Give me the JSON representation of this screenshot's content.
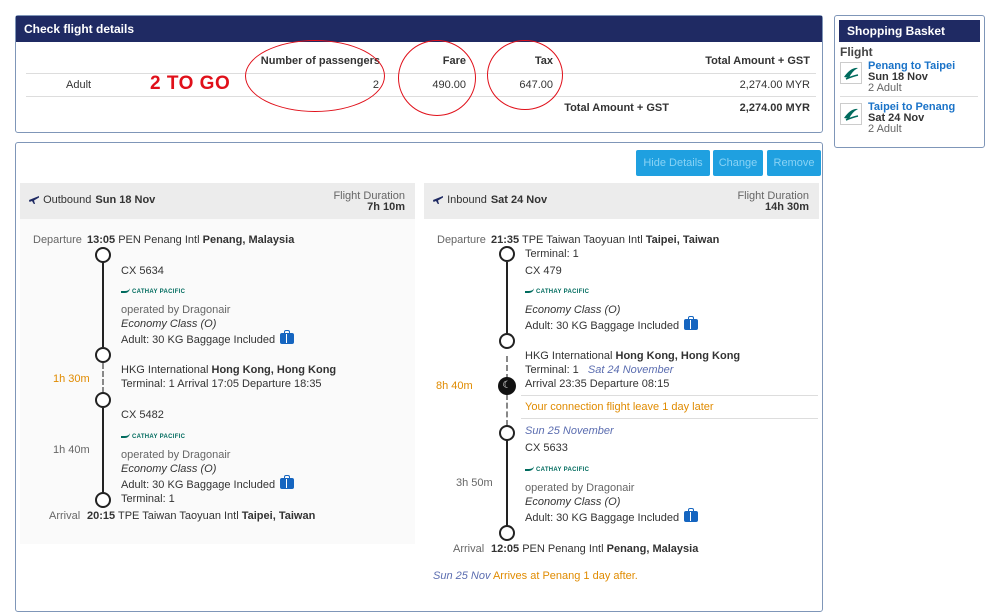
{
  "check": {
    "title": "Check flight details",
    "headers": {
      "passengers": "Number of passengers",
      "fare": "Fare",
      "tax": "Tax",
      "total": "Total Amount + GST"
    },
    "row": {
      "label": "Adult",
      "passengers": "2",
      "fare": "490.00",
      "tax": "647.00",
      "total": "2,274.00 MYR"
    },
    "total_label": "Total Amount + GST",
    "total_value": "2,274.00 MYR",
    "annotation": "2 TO GO",
    "annotation_color": "#e0101a"
  },
  "basket": {
    "title": "Shopping Basket",
    "section": "Flight",
    "items": [
      {
        "route": "Penang to Taipei",
        "date": "Sun 18 Nov",
        "pax": "2 Adult"
      },
      {
        "route": "Taipei to Penang",
        "date": "Sat 24 Nov",
        "pax": "2 Adult"
      }
    ]
  },
  "actions": {
    "hide_details": "Hide Details",
    "change": "Change",
    "remove": "Remove"
  },
  "outbound": {
    "label": "Outbound",
    "date": "Sun 18 Nov",
    "duration_label": "Flight Duration",
    "duration": "7h 10m",
    "departure_label": "Departure",
    "dep_time": "13:05",
    "dep_airport": "PEN Penang Intl",
    "dep_city": "Penang, Malaysia",
    "seg1": {
      "flight": "CX 5634",
      "airline": "CATHAY PACIFIC",
      "operated": "operated by Dragonair",
      "class": "Economy Class (O)",
      "baggage": "Adult: 30 KG Baggage Included"
    },
    "layover_time": "1h 30m",
    "transit_airport": "HKG International",
    "transit_city": "Hong Kong, Hong Kong",
    "transit_info": "Terminal: 1  Arrival 17:05 Departure 18:35",
    "seg2": {
      "flight": "CX 5482",
      "airline": "CATHAY PACIFIC",
      "flight_time": "1h 40m",
      "operated": "operated by Dragonair",
      "class": "Economy Class (O)",
      "baggage": "Adult: 30 KG Baggage Included",
      "terminal": "Terminal: 1"
    },
    "arrival_label": "Arrival",
    "arr_time": "20:15",
    "arr_airport": "TPE Taiwan Taoyuan Intl",
    "arr_city": "Taipei, Taiwan"
  },
  "inbound": {
    "label": "Inbound",
    "date": "Sat 24 Nov",
    "duration_label": "Flight Duration",
    "duration": "14h 30m",
    "departure_label": "Departure",
    "dep_time": "21:35",
    "dep_airport": "TPE Taiwan Taoyuan Intl",
    "dep_city": "Taipei, Taiwan",
    "dep_terminal": "Terminal: 1",
    "seg1": {
      "flight": "CX 479",
      "airline": "CATHAY PACIFIC",
      "class": "Economy Class (O)",
      "baggage": "Adult: 30 KG Baggage Included"
    },
    "transit_airport": "HKG International",
    "transit_city": "Hong Kong, Hong Kong",
    "transit_terminal": "Terminal: 1",
    "transit_date": "Sat 24 November",
    "layover_time": "8h 40m",
    "transit_info": "Arrival 23:35 Departure 08:15",
    "connection_note": "Your connection flight leave 1 day later",
    "seg2_date": "Sun 25 November",
    "seg2": {
      "flight": "CX 5633",
      "airline": "CATHAY PACIFIC",
      "flight_time": "3h 50m",
      "operated": "operated by Dragonair",
      "class": "Economy Class (O)",
      "baggage": "Adult: 30 KG Baggage Included"
    },
    "arrival_label": "Arrival",
    "arr_time": "12:05",
    "arr_airport": "PEN Penang Intl",
    "arr_city": "Penang, Malaysia",
    "footer_date": "Sun 25 Nov",
    "footer_note": "Arrives at Penang 1 day after."
  },
  "colors": {
    "header_bg": "#1f2a63",
    "button_bg": "#1fa0e0",
    "link_blue": "#1a73c8",
    "orange": "#e08b00",
    "annotation_red": "#e0101a"
  }
}
